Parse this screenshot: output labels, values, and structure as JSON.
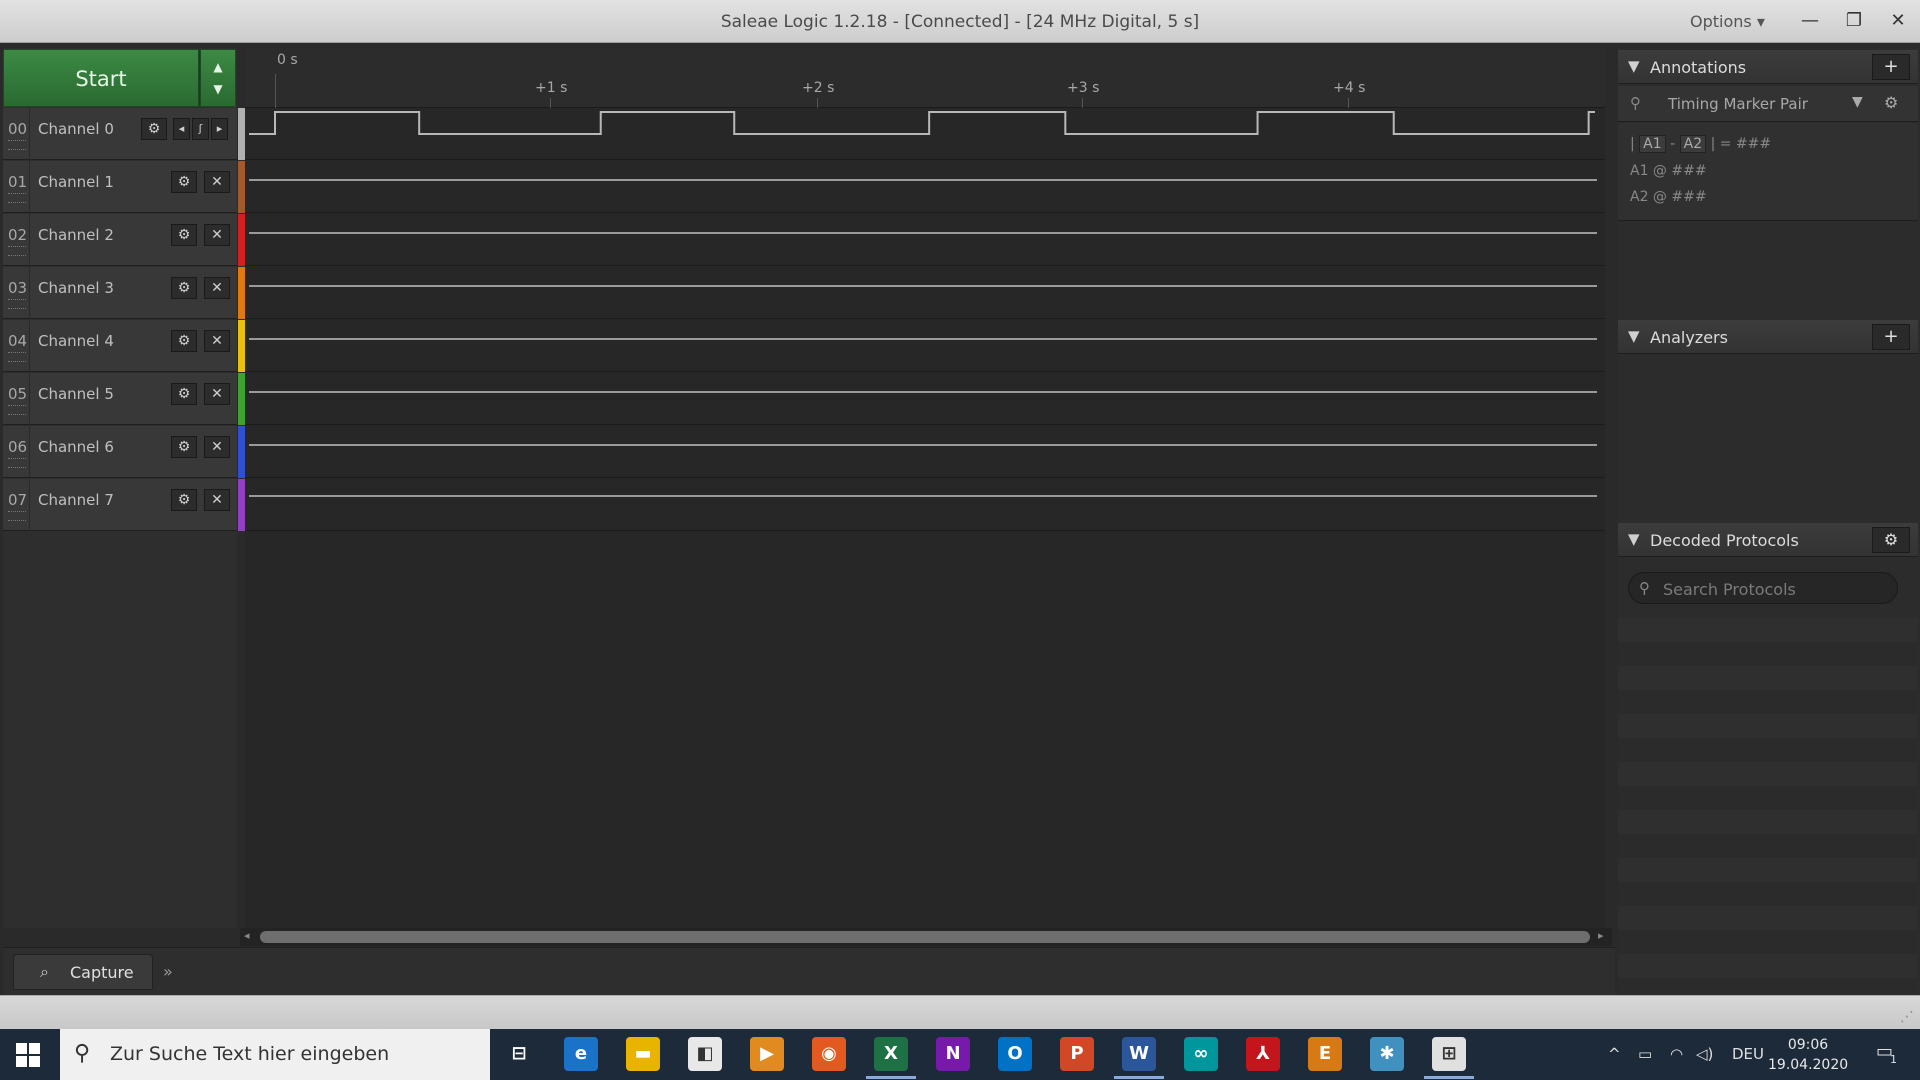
{
  "window": {
    "title": "Saleae Logic 1.2.18 - [Connected] - [24 MHz Digital, 5 s]",
    "options_label": "Options ▾",
    "minimize": "—",
    "restore": "❐",
    "close": "✕"
  },
  "capture": {
    "start_label": "Start",
    "up_arrow": "▲",
    "down_arrow": "▼"
  },
  "channels": [
    {
      "num": "00",
      "name": "Channel 0",
      "color": "#b0b0b0"
    },
    {
      "num": "01",
      "name": "Channel 1",
      "color": "#a05a2c"
    },
    {
      "num": "02",
      "name": "Channel 2",
      "color": "#d02020"
    },
    {
      "num": "03",
      "name": "Channel 3",
      "color": "#e07a10"
    },
    {
      "num": "04",
      "name": "Channel 4",
      "color": "#e8c010"
    },
    {
      "num": "05",
      "name": "Channel 5",
      "color": "#40a030"
    },
    {
      "num": "06",
      "name": "Channel 6",
      "color": "#3050d0"
    },
    {
      "num": "07",
      "name": "Channel 7",
      "color": "#9040c0"
    }
  ],
  "ruler": {
    "origin": "0 s",
    "ticks": [
      "+1 s",
      "+2 s",
      "+3 s",
      "+4 s"
    ]
  },
  "waveform_ch0": {
    "signal": "square",
    "edges_s": [
      0.0,
      0.54,
      1.22,
      1.72,
      2.45,
      2.96,
      3.68,
      4.19,
      4.92
    ],
    "initial_level": "low"
  },
  "icons": {
    "gear": "⚙",
    "close": "✕",
    "prev": "◂",
    "edge": "ʃ",
    "next": "▸"
  },
  "bottom": {
    "capture_tab": "Capture",
    "capture_icon": "⌕",
    "expand": "»"
  },
  "annotations": {
    "title": "Annotations",
    "add": "+",
    "marker_pair": "Timing Marker Pair",
    "pin_icon": "⚲",
    "dropdown": "▼",
    "gear": "⚙",
    "line1": {
      "bar": "|",
      "a1": "A1",
      "dash": "-",
      "a2": "A2",
      "eq": "| = ###"
    },
    "line2": "A1  @  ###",
    "line3": "A2  @  ###"
  },
  "analyzers": {
    "title": "Analyzers",
    "add": "+"
  },
  "decoded": {
    "title": "Decoded Protocols",
    "gear": "⚙",
    "search_placeholder": "Search Protocols",
    "search_icon": "🔍"
  },
  "taskbar": {
    "search_placeholder": "Zur Suche Text hier eingeben",
    "search_icon": "⚲",
    "apps": [
      {
        "name": "task-view",
        "glyph": "⊟",
        "color": "#1c2a3a"
      },
      {
        "name": "edge",
        "glyph": "e",
        "color": "#1a73c8"
      },
      {
        "name": "explorer",
        "glyph": "▬",
        "color": "#e8b400"
      },
      {
        "name": "store",
        "glyph": "◧",
        "color": "#e8e8e8"
      },
      {
        "name": "media",
        "glyph": "▶",
        "color": "#e08a20"
      },
      {
        "name": "firefox",
        "glyph": "◉",
        "color": "#e25a20"
      },
      {
        "name": "excel",
        "glyph": "X",
        "color": "#1e7145"
      },
      {
        "name": "onenote",
        "glyph": "N",
        "color": "#7719aa"
      },
      {
        "name": "outlook",
        "glyph": "O",
        "color": "#0072c6"
      },
      {
        "name": "powerpoint",
        "glyph": "P",
        "color": "#d24726"
      },
      {
        "name": "word",
        "glyph": "W",
        "color": "#2b579a"
      },
      {
        "name": "arduino",
        "glyph": "∞",
        "color": "#00979c"
      },
      {
        "name": "acrobat",
        "glyph": "⅄",
        "color": "#c4141c"
      },
      {
        "name": "eagle",
        "glyph": "E",
        "color": "#d87a14"
      },
      {
        "name": "settings-app",
        "glyph": "✱",
        "color": "#4090c0"
      },
      {
        "name": "logic",
        "glyph": "⊞",
        "color": "#e0e0e0"
      }
    ],
    "tray": {
      "chevron": "^",
      "battery": "▭",
      "wifi": "◠",
      "volume": "◁)",
      "lang": "DEU"
    },
    "time": "09:06",
    "date": "19.04.2020",
    "notif": "1"
  }
}
